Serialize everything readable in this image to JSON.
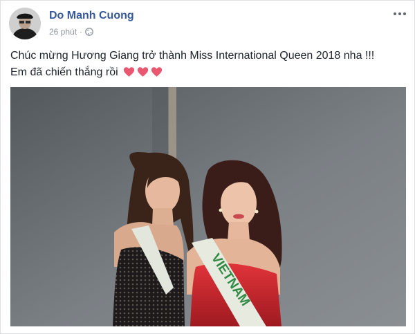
{
  "post": {
    "author": "Do Manh Cuong",
    "timestamp": "26 phút",
    "separator": "·",
    "privacy_icon": "globe-icon",
    "more_icon": "more-horizontal-icon",
    "text_line1": "Chúc mừng Hương Giang trở thành Miss International Queen 2018 nha !!!",
    "text_line2": "Em đã chiến thắng rồi",
    "hearts": [
      "heart-icon",
      "heart-icon",
      "heart-icon"
    ],
    "heart_color": "#e95770",
    "link_color": "#365899",
    "photo": {
      "sash_text": "VIETNAM",
      "sash_color": "#e6eadf",
      "sash_text_color": "#2f8a43",
      "dress_color": "#c8262d"
    }
  }
}
